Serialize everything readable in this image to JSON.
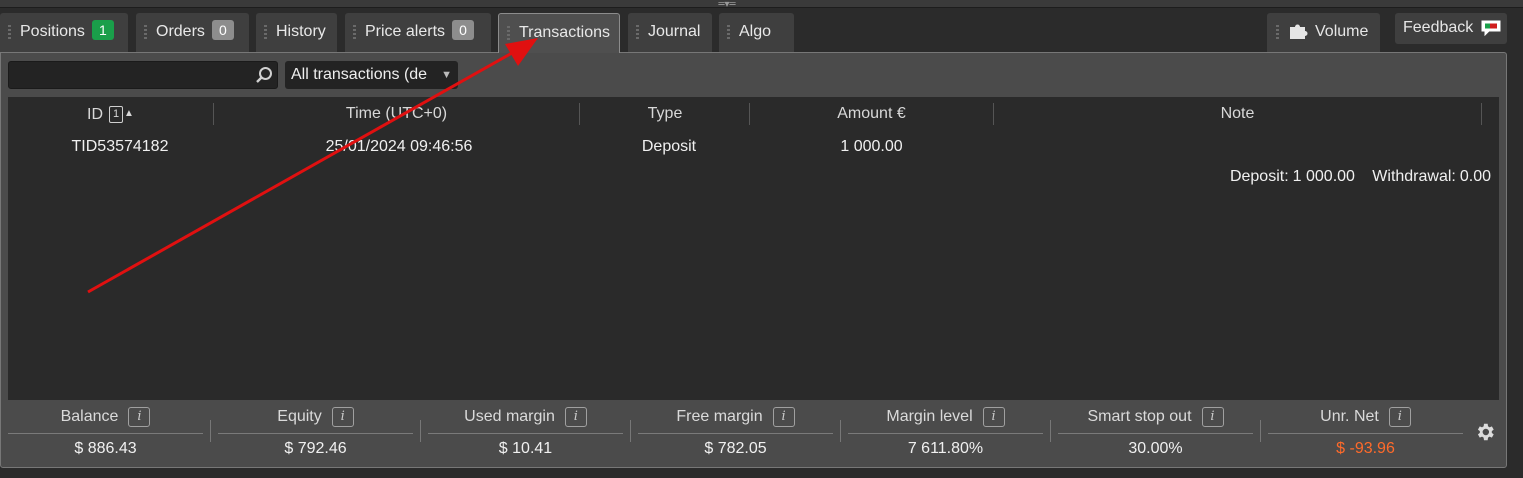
{
  "tabs": [
    {
      "label": "Positions",
      "badge": "1",
      "badge_color": "#1a9f4a"
    },
    {
      "label": "Orders",
      "badge": "0"
    },
    {
      "label": "History"
    },
    {
      "label": "Price alerts",
      "badge": "0"
    },
    {
      "label": "Transactions",
      "active": true
    },
    {
      "label": "Journal"
    },
    {
      "label": "Algo"
    }
  ],
  "right_tabs": {
    "volume_label": "Volume",
    "feedback_label": "Feedback"
  },
  "filters": {
    "search_value": "",
    "select_value": "All transactions (de"
  },
  "table": {
    "headers": {
      "id": "ID",
      "sort_index": "1",
      "time": "Time (UTC+0)",
      "type": "Type",
      "amount": "Amount €",
      "note": "Note"
    },
    "rows": [
      {
        "id": "TID53574182",
        "time": "25/01/2024 09:46:56",
        "type": "Deposit",
        "amount": "1 000.00",
        "note": ""
      }
    ],
    "summary": {
      "deposit_label": "Deposit:",
      "deposit_value": "1 000.00",
      "withdrawal_label": "Withdrawal:",
      "withdrawal_value": "0.00"
    }
  },
  "stats": [
    {
      "label": "Balance",
      "value": "$ 886.43"
    },
    {
      "label": "Equity",
      "value": "$ 792.46"
    },
    {
      "label": "Used margin",
      "value": "$ 10.41"
    },
    {
      "label": "Free margin",
      "value": "$ 782.05"
    },
    {
      "label": "Margin level",
      "value": "7 611.80%"
    },
    {
      "label": "Smart stop out",
      "value": "30.00%"
    },
    {
      "label": "Unr. Net",
      "value": "$ -93.96",
      "color": "#ff6a2a"
    }
  ],
  "colors": {
    "annotation_arrow": "#e01010",
    "negative_value": "#ff6a2a"
  }
}
